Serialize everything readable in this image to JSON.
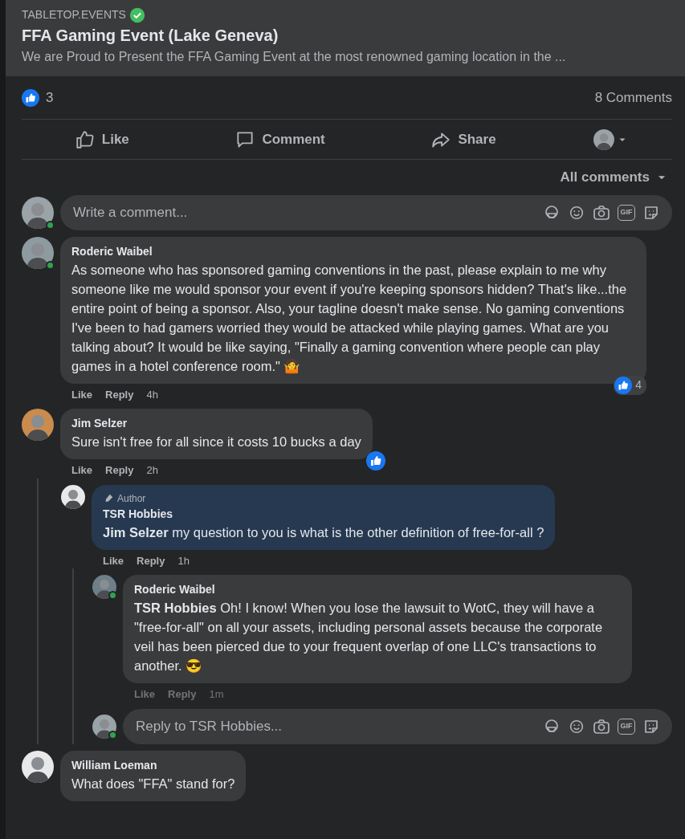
{
  "link_preview": {
    "domain": "TABLETOP.EVENTS",
    "verified": true,
    "title": "FFA Gaming Event (Lake Geneva)",
    "description": "We are Proud to Present the FFA Gaming Event at the most renowned gaming location in the ..."
  },
  "summary": {
    "likes": "3",
    "comments": "8 Comments"
  },
  "actions": [
    {
      "kind": "like",
      "label": "Like"
    },
    {
      "kind": "comment",
      "label": "Comment"
    },
    {
      "kind": "share",
      "label": "Share"
    }
  ],
  "filter": "All comments",
  "composer": {
    "placeholder": "Write a comment...",
    "gif_label": "GIF"
  },
  "comments": [
    {
      "author": "Roderic Waibel",
      "online": true,
      "is_author": false,
      "text": "As someone who has sponsored gaming conventions in the past, please explain to me why someone like me would sponsor your event if you're keeping sponsors hidden? That's like...the entire point of being a sponsor. Also, your tagline doesn't make sense. No gaming conventions I've been to had gamers worried they would be attacked while playing games. What are you talking about? It would be like saying, \"Finally a gaming convention where people can play games in a hotel conference room.\" 🤷",
      "like": "Like",
      "reply": "Reply",
      "time": "4h",
      "reactions": "4",
      "liked": true
    },
    {
      "author": "Jim Selzer",
      "online": false,
      "is_author": false,
      "text": "Sure isn't free for all since it costs 10 bucks a day",
      "like": "Like",
      "reply": "Reply",
      "time": "2h",
      "liked": true,
      "replies": [
        {
          "author": "TSR Hobbies",
          "online": false,
          "is_author": true,
          "badge": "Author",
          "text": "**Jim Selzer** my question to you is what is the other definition of free-for-all ?",
          "like": "Like",
          "reply": "Reply",
          "time": "1h",
          "liked": false,
          "replies": [
            {
              "author": "Roderic Waibel",
              "online": true,
              "is_author": false,
              "text": "**TSR Hobbies** Oh! I know! When you lose the lawsuit to WotC, they will have a \"free-for-all\" on all your assets, including personal assets because the corporate veil has been pierced due to your frequent overlap of one LLC's transactions to another. 😎",
              "like": "Like",
              "reply": "Reply",
              "time": "1m",
              "liked": false,
              "dimmed": true
            }
          ],
          "reply_composer": {
            "placeholder": "Reply to TSR Hobbies...",
            "gif_label": "GIF",
            "online": true
          }
        }
      ]
    },
    {
      "author": "William Loeman",
      "online": false,
      "is_author": false,
      "text": "What does \"FFA\" stand for?",
      "liked": false
    }
  ]
}
